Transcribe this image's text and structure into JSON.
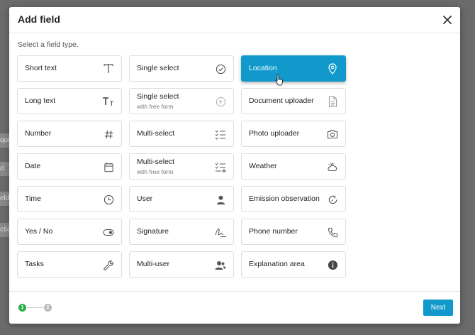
{
  "background_fragments": [
    "qui",
    "d",
    "eld",
    "ctio"
  ],
  "modal": {
    "title": "Add field",
    "subtitle": "Select a field type.",
    "close_icon": "close-icon"
  },
  "colors": {
    "accent": "#1299cc",
    "step_active": "#2bb04a",
    "step_inactive": "#b9b9b9"
  },
  "field_types": [
    {
      "label": "Short text",
      "icon": "text-icon"
    },
    {
      "label": "Single select",
      "icon": "check-circle-icon"
    },
    {
      "label": "Location",
      "icon": "location-pin-icon",
      "selected": true
    },
    {
      "label": "Long text",
      "icon": "text-size-icon"
    },
    {
      "label": "Single select",
      "sub": "with free form",
      "icon": "plus-circle-icon"
    },
    {
      "label": "Document uploader",
      "icon": "document-icon"
    },
    {
      "label": "Number",
      "icon": "hash-icon"
    },
    {
      "label": "Multi-select",
      "icon": "checklist-icon"
    },
    {
      "label": "Photo uploader",
      "icon": "camera-icon"
    },
    {
      "label": "Date",
      "icon": "calendar-icon"
    },
    {
      "label": "Multi-select",
      "sub": "with free form",
      "icon": "checklist-plus-icon"
    },
    {
      "label": "Weather",
      "icon": "weather-icon"
    },
    {
      "label": "Time",
      "icon": "clock-icon"
    },
    {
      "label": "User",
      "icon": "user-icon"
    },
    {
      "label": "Emission observation",
      "icon": "emission-icon"
    },
    {
      "label": "Yes / No",
      "icon": "toggle-icon"
    },
    {
      "label": "Signature",
      "icon": "signature-icon"
    },
    {
      "label": "Phone number",
      "icon": "phone-icon"
    },
    {
      "label": "Tasks",
      "icon": "wrench-icon"
    },
    {
      "label": "Multi-user",
      "icon": "users-icon"
    },
    {
      "label": "Explanation area",
      "icon": "info-icon"
    }
  ],
  "footer": {
    "steps": [
      "1",
      "2"
    ],
    "next_label": "Next"
  }
}
